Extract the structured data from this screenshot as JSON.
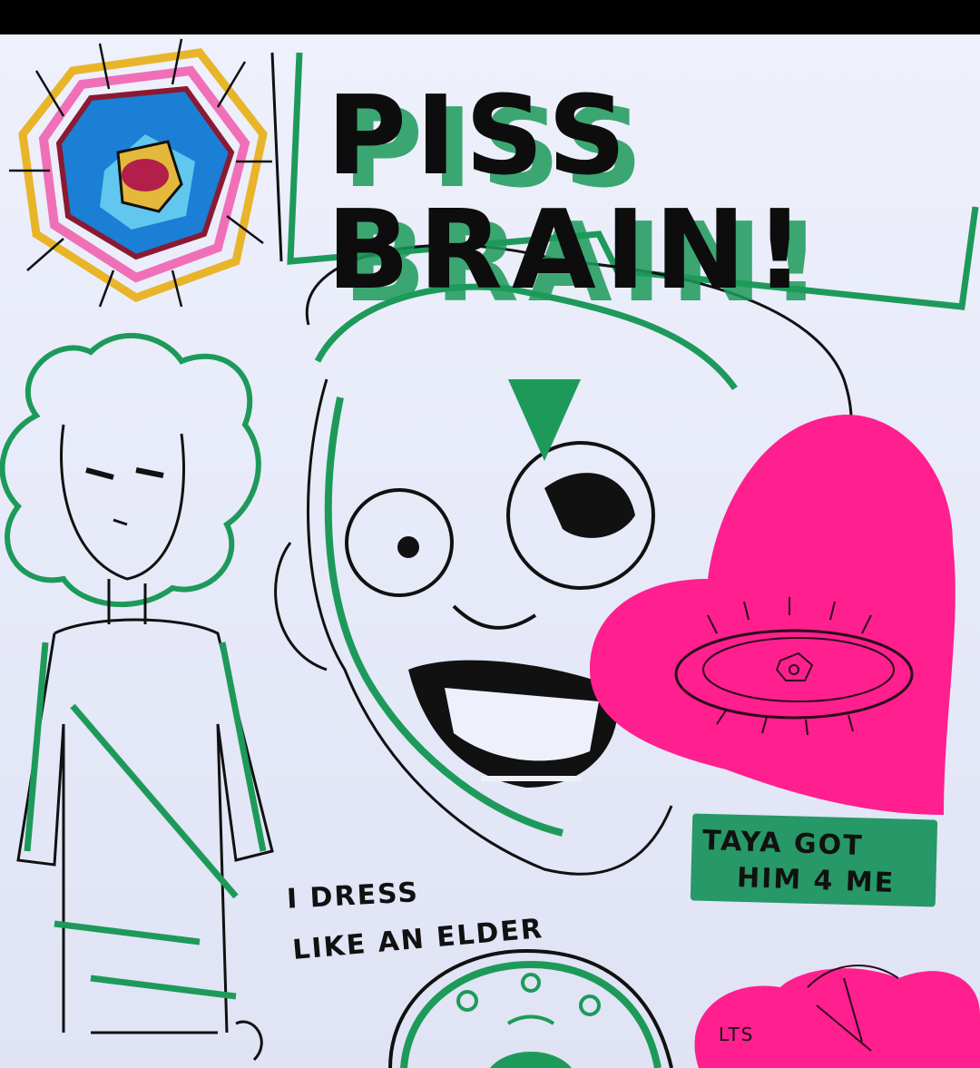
{
  "texts": {
    "title": "PISS BRAIN!",
    "note_line1": "TAYA GOT",
    "note_line2": "HIM 4 ME",
    "dress_line1": "I DRESS",
    "dress_line2": "LIKE AN ELDER",
    "sticky_fragment": "LTS"
  },
  "colors": {
    "paper": "#e9ecfa",
    "ink": "#111111",
    "marker_green": "#1d9a5a",
    "sticky_pink": "#ff1f8f"
  }
}
